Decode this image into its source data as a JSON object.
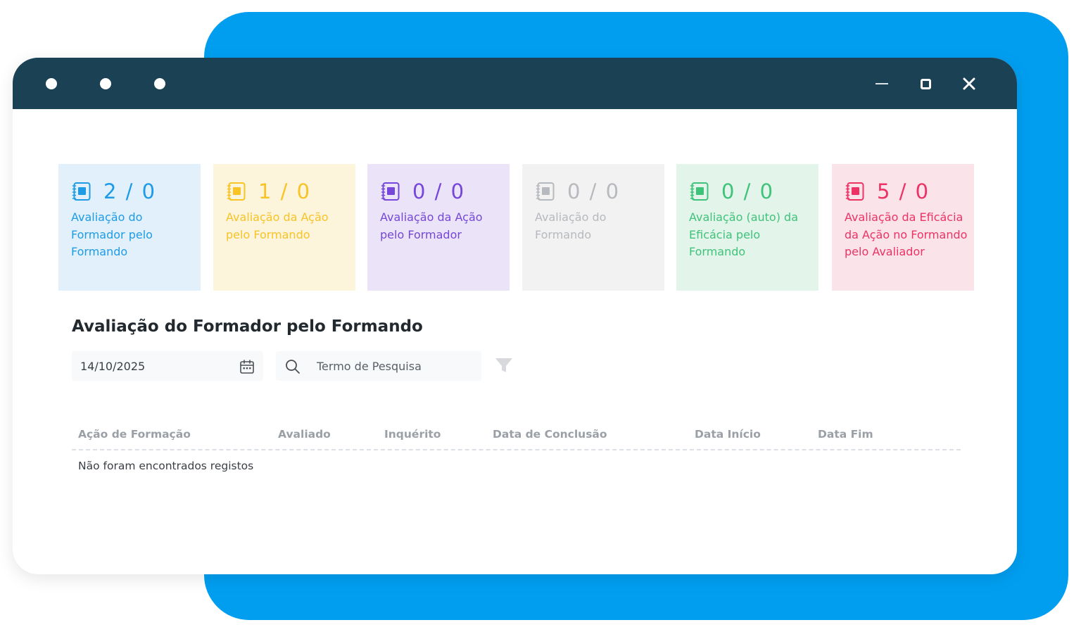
{
  "window": {
    "controls": [
      "minimize-icon",
      "maximize-icon",
      "close-icon"
    ]
  },
  "cards": [
    {
      "count": "2 / 0",
      "label": "Avaliação do Formador pelo Formando",
      "color": "#1e9be6",
      "bg": "#e1f0fa"
    },
    {
      "count": "1 / 0",
      "label": "Avaliação da Ação pelo Formando",
      "color": "#f7c325",
      "bg": "#fdf4dc"
    },
    {
      "count": "0 / 0",
      "label": "Avaliação da Ação pelo Formador",
      "color": "#7546d9",
      "bg": "#ebe4f8"
    },
    {
      "count": "0 / 0",
      "label": "Avaliação do Formando",
      "color": "#b6b9bd",
      "bg": "#f2f2f2"
    },
    {
      "count": "0 / 0",
      "label": "Avaliação (auto) da Eficácia pelo Formando",
      "color": "#3fc27a",
      "bg": "#e3f5ea"
    },
    {
      "count": "5 / 0",
      "label": "Avaliação da Eficácia da Ação no Formando pelo Avaliador",
      "color": "#ec3364",
      "bg": "#fbe3ea"
    }
  ],
  "section": {
    "title": "Avaliação do Formador pelo Formando"
  },
  "filters": {
    "date_value": "14/10/2025",
    "search_placeholder": "Termo de Pesquisa",
    "icons": [
      "calendar-icon",
      "search-icon",
      "filter-icon"
    ]
  },
  "table": {
    "columns": [
      "Ação de Formação",
      "Avaliado",
      "Inquérito",
      "Data de Conclusão",
      "Data Início",
      "Data Fim"
    ],
    "empty_message": "Não foram encontrados registos"
  },
  "colors": {
    "titlebar": "#1a4254",
    "backdrop": "#019ef0"
  }
}
